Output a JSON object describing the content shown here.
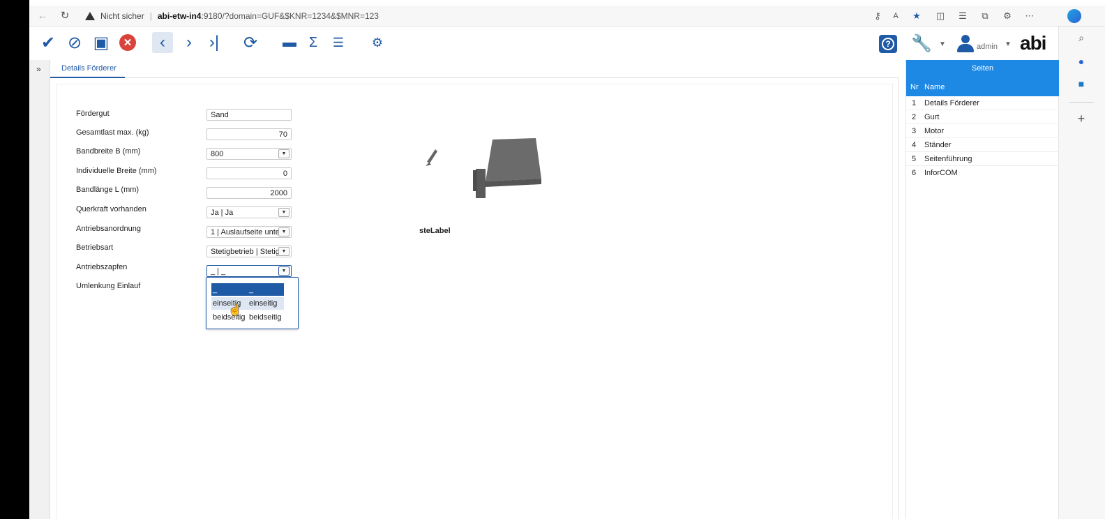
{
  "browser": {
    "security": "Nicht sicher",
    "separator": "|",
    "url_host": "abi-etw-in4",
    "url_rest": ":9180/?domain=GUF&$KNR=1234&$MNR=123"
  },
  "user": {
    "name": "admin"
  },
  "logo": "abi",
  "tab": {
    "label": "Details Förderer"
  },
  "form": {
    "fields": [
      {
        "label": "Fördergut",
        "value": "Sand"
      },
      {
        "label": "Gesamtlast max. (kg)",
        "value": "70"
      },
      {
        "label": "Bandbreite B (mm)",
        "value": "800"
      },
      {
        "label": "Individuelle Breite (mm)",
        "value": "0"
      },
      {
        "label": "Bandlänge L (mm)",
        "value": "2000"
      },
      {
        "label": "Querkraft vorhanden",
        "value": "Ja | Ja"
      },
      {
        "label": "Antriebsanordnung",
        "value": "1 | Auslaufseite unte"
      },
      {
        "label": "Betriebsart",
        "value": "Stetigbetrieb | Stetig"
      },
      {
        "label": "Antriebszapfen",
        "value": "_ | _"
      },
      {
        "label": "Umlenkung Einlauf",
        "value": ""
      }
    ],
    "dropdown_options": [
      {
        "code": "_",
        "text": "_"
      },
      {
        "code": "einseitig",
        "text": "einseitig"
      },
      {
        "code": "beidseitig",
        "text": "beidseitig"
      }
    ],
    "ste_label": "steLabel"
  },
  "seiten": {
    "title": "Seiten",
    "col_nr": "Nr",
    "col_name": "Name",
    "rows": [
      {
        "nr": "1",
        "name": "Details Förderer"
      },
      {
        "nr": "2",
        "name": "Gurt"
      },
      {
        "nr": "3",
        "name": "Motor"
      },
      {
        "nr": "4",
        "name": "Ständer"
      },
      {
        "nr": "5",
        "name": "Seitenführung"
      },
      {
        "nr": "6",
        "name": "InforCOM"
      }
    ]
  },
  "colors": {
    "accent": "#1f5aa6",
    "panel_header": "#1e88e5",
    "danger": "#d9433b"
  }
}
